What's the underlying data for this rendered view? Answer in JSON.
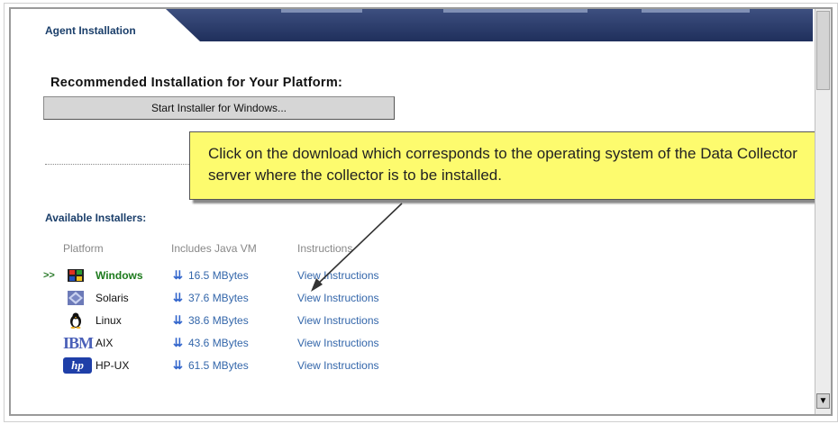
{
  "tab": {
    "label": "Agent Installation"
  },
  "recommended": {
    "title": "Recommended Installation for Your Platform:",
    "button_label": "Start Installer for Windows..."
  },
  "callout": {
    "text": "Click on the download which corresponds to the operating system of the Data Collector server where the collector is to be installed."
  },
  "available": {
    "title": "Available Installers:",
    "columns": [
      "Platform",
      "Includes Java VM",
      "Instructions"
    ],
    "rows": [
      {
        "marker": ">>",
        "platform": "Windows",
        "size": "16.5 MBytes",
        "instructions": "View Instructions",
        "icon": "windows-icon",
        "selected": true
      },
      {
        "marker": "",
        "platform": "Solaris",
        "size": "37.6 MBytes",
        "instructions": "View Instructions",
        "icon": "solaris-icon",
        "selected": false
      },
      {
        "marker": "",
        "platform": "Linux",
        "size": "38.6 MBytes",
        "instructions": "View Instructions",
        "icon": "linux-penguin-icon",
        "selected": false
      },
      {
        "marker": "",
        "platform": "AIX",
        "size": "43.6 MBytes",
        "instructions": "View Instructions",
        "icon": "ibm-logo-icon",
        "selected": false
      },
      {
        "marker": "",
        "platform": "HP-UX",
        "size": "61.5 MBytes",
        "instructions": "View Instructions",
        "icon": "hp-logo-icon",
        "selected": false
      }
    ],
    "ibm_logo_text": "IBM",
    "hp_logo_text": "hp"
  },
  "colors": {
    "header": "#2a3b6b",
    "link": "#3366aa",
    "selected": "#1d7a1d",
    "callout": "#fdfb6e"
  }
}
